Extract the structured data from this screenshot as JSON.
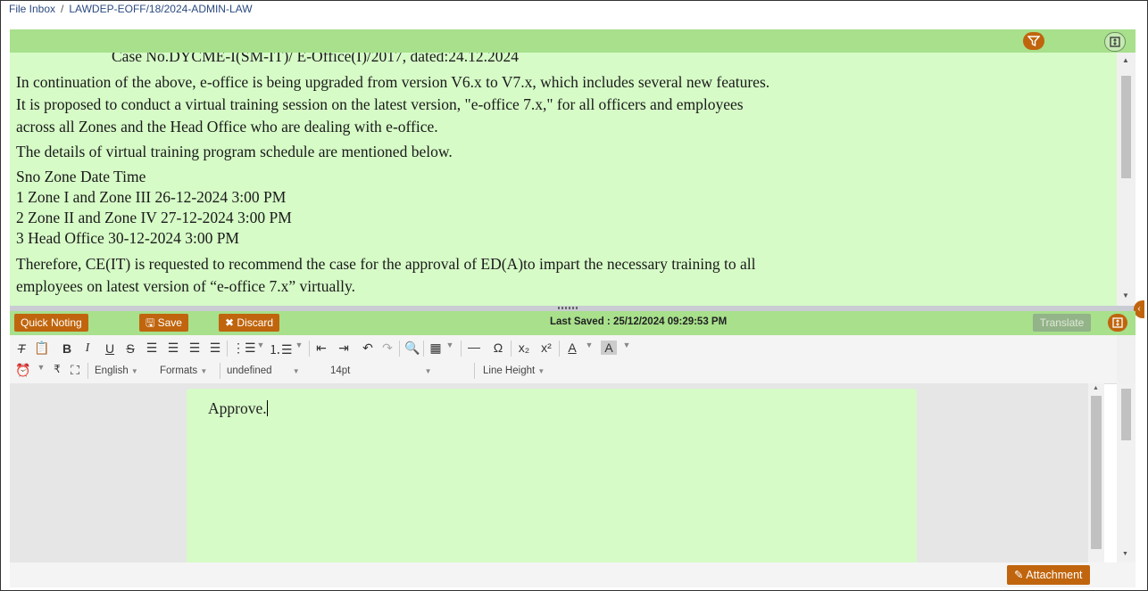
{
  "breadcrumb": {
    "root": "File Inbox",
    "separator": "/",
    "file": "LAWDEP-EOFF/18/2024-ADMIN-LAW"
  },
  "notes": {
    "cut_line": "Case No.DYCME-I(SM-IT)/ E-Office(I)/2017, dated:24.12.2024",
    "para1_line1": "In continuation of the above, e-office is being upgraded from version V6.x to V7.x, which includes several new features.",
    "para1_line2": "It is proposed to conduct a virtual training session on the latest version, \"e-office 7.x,\" for all officers and employees",
    "para1_line3": "across all Zones and the Head Office who are dealing with e-office.",
    "para2": "The details of virtual training program schedule are mentioned below.",
    "schedule_header": "Sno Zone Date Time",
    "schedule": [
      "1 Zone I and Zone III 26-12-2024 3:00 PM",
      "2 Zone II and Zone IV 27-12-2024 3:00 PM",
      "3 Head Office 30-12-2024 3:00 PM"
    ],
    "para3_line1": "Therefore, CE(IT) is requested to recommend the case for the approval of ED(A)to impart the necessary training to all",
    "para3_line2": "employees on latest version of “e-office 7.x” virtually."
  },
  "toolbar": {
    "quick_noting": "Quick Noting",
    "save": "Save",
    "discard": "Discard",
    "last_saved": "Last Saved : 25/12/2024 09:29:53 PM",
    "translate": "Translate"
  },
  "editor_toolbar": {
    "language": "English",
    "formats": "Formats",
    "font": "undefined",
    "size": "14pt",
    "line_height": "Line Height"
  },
  "editor": {
    "content": "Approve."
  },
  "attachment": "Attachment",
  "colors": {
    "accent": "#c0650d",
    "header_green": "#a8e08c",
    "note_bg": "#d6fbc7"
  }
}
